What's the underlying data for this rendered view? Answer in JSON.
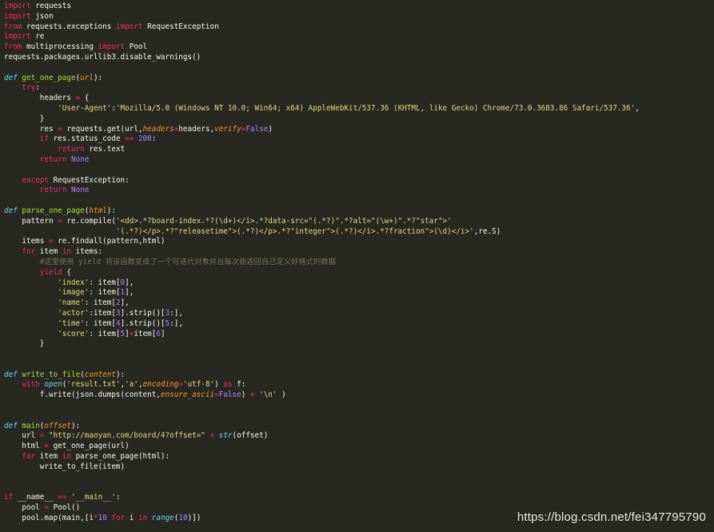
{
  "editor": {
    "colors": {
      "background": "#272822",
      "default": "#f8f8f2",
      "keyword": "#f92672",
      "function": "#a6e22e",
      "string": "#e6db74",
      "number": "#ae81ff",
      "constant": "#ae81ff",
      "param": "#fd971f",
      "builtin": "#66d9ef",
      "comment": "#75715e"
    },
    "lines": [
      {
        "tokens": [
          {
            "t": "import",
            "k": "kw"
          },
          {
            "t": " requests"
          }
        ]
      },
      {
        "tokens": [
          {
            "t": "import",
            "k": "kw"
          },
          {
            "t": " json"
          }
        ]
      },
      {
        "tokens": [
          {
            "t": "from",
            "k": "kw"
          },
          {
            "t": " requests.exceptions "
          },
          {
            "t": "import",
            "k": "kw"
          },
          {
            "t": " RequestException"
          }
        ]
      },
      {
        "tokens": [
          {
            "t": "import",
            "k": "kw"
          },
          {
            "t": " re"
          }
        ]
      },
      {
        "tokens": [
          {
            "t": "from",
            "k": "kw"
          },
          {
            "t": " multiprocessing "
          },
          {
            "t": "import",
            "k": "kw"
          },
          {
            "t": " Pool"
          }
        ]
      },
      {
        "tokens": [
          {
            "t": "requests.packages.urllib3.disable_warnings()"
          }
        ]
      },
      {
        "tokens": []
      },
      {
        "tokens": [
          {
            "t": "def",
            "k": "def"
          },
          {
            "t": " "
          },
          {
            "t": "get_one_page",
            "k": "fn"
          },
          {
            "t": "("
          },
          {
            "t": "url",
            "k": "param"
          },
          {
            "t": "):"
          }
        ]
      },
      {
        "tokens": [
          {
            "t": "    "
          },
          {
            "t": "try",
            "k": "kw"
          },
          {
            "t": ":"
          }
        ]
      },
      {
        "tokens": [
          {
            "t": "        headers "
          },
          {
            "t": "=",
            "k": "kw"
          },
          {
            "t": " {"
          }
        ]
      },
      {
        "tokens": [
          {
            "t": "            "
          },
          {
            "t": "'User-Agent'",
            "k": "str"
          },
          {
            "t": ":"
          },
          {
            "t": "'Mozilla/5.0 (Windows NT 10.0; Win64; x64) AppleWebKit/537.36 (KHTML, like Gecko) Chrome/73.0.3683.86 Safari/537.36'",
            "k": "str"
          },
          {
            "t": ","
          }
        ]
      },
      {
        "tokens": [
          {
            "t": "        }"
          }
        ]
      },
      {
        "tokens": [
          {
            "t": "        res "
          },
          {
            "t": "=",
            "k": "kw"
          },
          {
            "t": " requests.get(url,"
          },
          {
            "t": "headers",
            "k": "param"
          },
          {
            "t": "=",
            "k": "kw"
          },
          {
            "t": "headers,"
          },
          {
            "t": "verify",
            "k": "param"
          },
          {
            "t": "=",
            "k": "kw"
          },
          {
            "t": "False",
            "k": "const"
          },
          {
            "t": ")"
          }
        ]
      },
      {
        "tokens": [
          {
            "t": "        "
          },
          {
            "t": "if",
            "k": "kw"
          },
          {
            "t": " res.status_code "
          },
          {
            "t": "==",
            "k": "kw"
          },
          {
            "t": " "
          },
          {
            "t": "200",
            "k": "num"
          },
          {
            "t": ":"
          }
        ]
      },
      {
        "tokens": [
          {
            "t": "            "
          },
          {
            "t": "return",
            "k": "kw"
          },
          {
            "t": " res.text"
          }
        ]
      },
      {
        "tokens": [
          {
            "t": "        "
          },
          {
            "t": "return",
            "k": "kw"
          },
          {
            "t": " "
          },
          {
            "t": "None",
            "k": "const"
          }
        ]
      },
      {
        "tokens": []
      },
      {
        "tokens": [
          {
            "t": "    "
          },
          {
            "t": "except",
            "k": "kw"
          },
          {
            "t": " RequestException:"
          }
        ]
      },
      {
        "tokens": [
          {
            "t": "        "
          },
          {
            "t": "return",
            "k": "kw"
          },
          {
            "t": " "
          },
          {
            "t": "None",
            "k": "const"
          }
        ]
      },
      {
        "tokens": []
      },
      {
        "tokens": [
          {
            "t": "def",
            "k": "def"
          },
          {
            "t": " "
          },
          {
            "t": "parse_one_page",
            "k": "fn"
          },
          {
            "t": "("
          },
          {
            "t": "html",
            "k": "param"
          },
          {
            "t": "):"
          }
        ]
      },
      {
        "tokens": [
          {
            "t": "    pattern "
          },
          {
            "t": "=",
            "k": "kw"
          },
          {
            "t": " re.compile("
          },
          {
            "t": "'<dd>.*?board-index.*?(\\d+)</i>.*?data-src=\"(.*?)\".*?alt=\"(\\w+)\".*?\"star\">'",
            "k": "str"
          }
        ]
      },
      {
        "tokens": [
          {
            "t": "                         "
          },
          {
            "t": "'(.*?)</p>.*?\"releasetime\">(.*?)</p>.*?\"integer\">(.*?)</i>.*?fraction\">(\\d)</i>'",
            "k": "str"
          },
          {
            "t": ",re.S)"
          }
        ]
      },
      {
        "tokens": [
          {
            "t": "    items "
          },
          {
            "t": "=",
            "k": "kw"
          },
          {
            "t": " re.findall(pattern,html)"
          }
        ]
      },
      {
        "tokens": [
          {
            "t": "    "
          },
          {
            "t": "for",
            "k": "kw"
          },
          {
            "t": " item "
          },
          {
            "t": "in",
            "k": "kw"
          },
          {
            "t": " items:"
          }
        ]
      },
      {
        "tokens": [
          {
            "t": "        "
          },
          {
            "t": "#这里使用 yield 将该函数变成了一个可迭代对象并且每次能返回自己定义好格式的数据",
            "k": "comment"
          }
        ]
      },
      {
        "tokens": [
          {
            "t": "        "
          },
          {
            "t": "yield",
            "k": "kw"
          },
          {
            "t": " {"
          }
        ]
      },
      {
        "tokens": [
          {
            "t": "            "
          },
          {
            "t": "'index'",
            "k": "str"
          },
          {
            "t": ": item["
          },
          {
            "t": "0",
            "k": "num"
          },
          {
            "t": "],"
          }
        ]
      },
      {
        "tokens": [
          {
            "t": "            "
          },
          {
            "t": "'image'",
            "k": "str"
          },
          {
            "t": ": item["
          },
          {
            "t": "1",
            "k": "num"
          },
          {
            "t": "],"
          }
        ]
      },
      {
        "tokens": [
          {
            "t": "            "
          },
          {
            "t": "'name'",
            "k": "str"
          },
          {
            "t": ": item["
          },
          {
            "t": "2",
            "k": "num"
          },
          {
            "t": "],"
          }
        ]
      },
      {
        "tokens": [
          {
            "t": "            "
          },
          {
            "t": "'actor'",
            "k": "str"
          },
          {
            "t": ":item["
          },
          {
            "t": "3",
            "k": "num"
          },
          {
            "t": "].strip()["
          },
          {
            "t": "3",
            "k": "num"
          },
          {
            "t": ":],"
          }
        ]
      },
      {
        "tokens": [
          {
            "t": "            "
          },
          {
            "t": "'time'",
            "k": "str"
          },
          {
            "t": ": item["
          },
          {
            "t": "4",
            "k": "num"
          },
          {
            "t": "].strip()["
          },
          {
            "t": "5",
            "k": "num"
          },
          {
            "t": ":],"
          }
        ]
      },
      {
        "tokens": [
          {
            "t": "            "
          },
          {
            "t": "'score'",
            "k": "str"
          },
          {
            "t": ": item["
          },
          {
            "t": "5",
            "k": "num"
          },
          {
            "t": "]"
          },
          {
            "t": "+",
            "k": "kw"
          },
          {
            "t": "item["
          },
          {
            "t": "6",
            "k": "num"
          },
          {
            "t": "]"
          }
        ]
      },
      {
        "tokens": [
          {
            "t": "        }"
          }
        ]
      },
      {
        "tokens": []
      },
      {
        "tokens": []
      },
      {
        "tokens": [
          {
            "t": "def",
            "k": "def"
          },
          {
            "t": " "
          },
          {
            "t": "write_to_file",
            "k": "fn"
          },
          {
            "t": "("
          },
          {
            "t": "content",
            "k": "param"
          },
          {
            "t": "):"
          }
        ]
      },
      {
        "tokens": [
          {
            "t": "    "
          },
          {
            "t": "with",
            "k": "kw"
          },
          {
            "t": " "
          },
          {
            "t": "open",
            "k": "builtin"
          },
          {
            "t": "("
          },
          {
            "t": "'result.txt'",
            "k": "str"
          },
          {
            "t": ","
          },
          {
            "t": "'a'",
            "k": "str"
          },
          {
            "t": ","
          },
          {
            "t": "encoding",
            "k": "param"
          },
          {
            "t": "=",
            "k": "kw"
          },
          {
            "t": "'utf-8'",
            "k": "str"
          },
          {
            "t": ") "
          },
          {
            "t": "as",
            "k": "kw"
          },
          {
            "t": " f:"
          }
        ]
      },
      {
        "tokens": [
          {
            "t": "        f.write(json.dumps(content,"
          },
          {
            "t": "ensure_ascii",
            "k": "param"
          },
          {
            "t": "=",
            "k": "kw"
          },
          {
            "t": "False",
            "k": "const"
          },
          {
            "t": ") "
          },
          {
            "t": "+",
            "k": "kw"
          },
          {
            "t": " "
          },
          {
            "t": "'\\n'",
            "k": "str"
          },
          {
            "t": " )"
          }
        ]
      },
      {
        "tokens": []
      },
      {
        "tokens": []
      },
      {
        "tokens": [
          {
            "t": "def",
            "k": "def"
          },
          {
            "t": " "
          },
          {
            "t": "main",
            "k": "fn"
          },
          {
            "t": "("
          },
          {
            "t": "offset",
            "k": "param"
          },
          {
            "t": "):"
          }
        ]
      },
      {
        "tokens": [
          {
            "t": "    url "
          },
          {
            "t": "=",
            "k": "kw"
          },
          {
            "t": " "
          },
          {
            "t": "\"http://maoyan.com/board/4?offset=\"",
            "k": "str"
          },
          {
            "t": " "
          },
          {
            "t": "+",
            "k": "kw"
          },
          {
            "t": " "
          },
          {
            "t": "str",
            "k": "builtin"
          },
          {
            "t": "(offset)"
          }
        ]
      },
      {
        "tokens": [
          {
            "t": "    html "
          },
          {
            "t": "=",
            "k": "kw"
          },
          {
            "t": " get_one_page(url)"
          }
        ]
      },
      {
        "tokens": [
          {
            "t": "    "
          },
          {
            "t": "for",
            "k": "kw"
          },
          {
            "t": " item "
          },
          {
            "t": "in",
            "k": "kw"
          },
          {
            "t": " parse_one_page(html):"
          }
        ]
      },
      {
        "tokens": [
          {
            "t": "        write_to_file(item)"
          }
        ]
      },
      {
        "tokens": []
      },
      {
        "tokens": []
      },
      {
        "tokens": [
          {
            "t": "if",
            "k": "kw"
          },
          {
            "t": " __name__ "
          },
          {
            "t": "==",
            "k": "kw"
          },
          {
            "t": " "
          },
          {
            "t": "'__main__'",
            "k": "str"
          },
          {
            "t": ":"
          }
        ]
      },
      {
        "tokens": [
          {
            "t": "    pool "
          },
          {
            "t": "=",
            "k": "kw"
          },
          {
            "t": " Pool()"
          }
        ]
      },
      {
        "tokens": [
          {
            "t": "    pool.map(main,[i"
          },
          {
            "t": "*",
            "k": "kw"
          },
          {
            "t": "10",
            "k": "num"
          },
          {
            "t": " "
          },
          {
            "t": "for",
            "k": "kw"
          },
          {
            "t": " i "
          },
          {
            "t": "in",
            "k": "kw"
          },
          {
            "t": " "
          },
          {
            "t": "range",
            "k": "builtin"
          },
          {
            "t": "("
          },
          {
            "t": "10",
            "k": "num"
          },
          {
            "t": ")])"
          }
        ]
      }
    ]
  },
  "watermark": {
    "text": "https://blog.csdn.net/fei347795790"
  }
}
